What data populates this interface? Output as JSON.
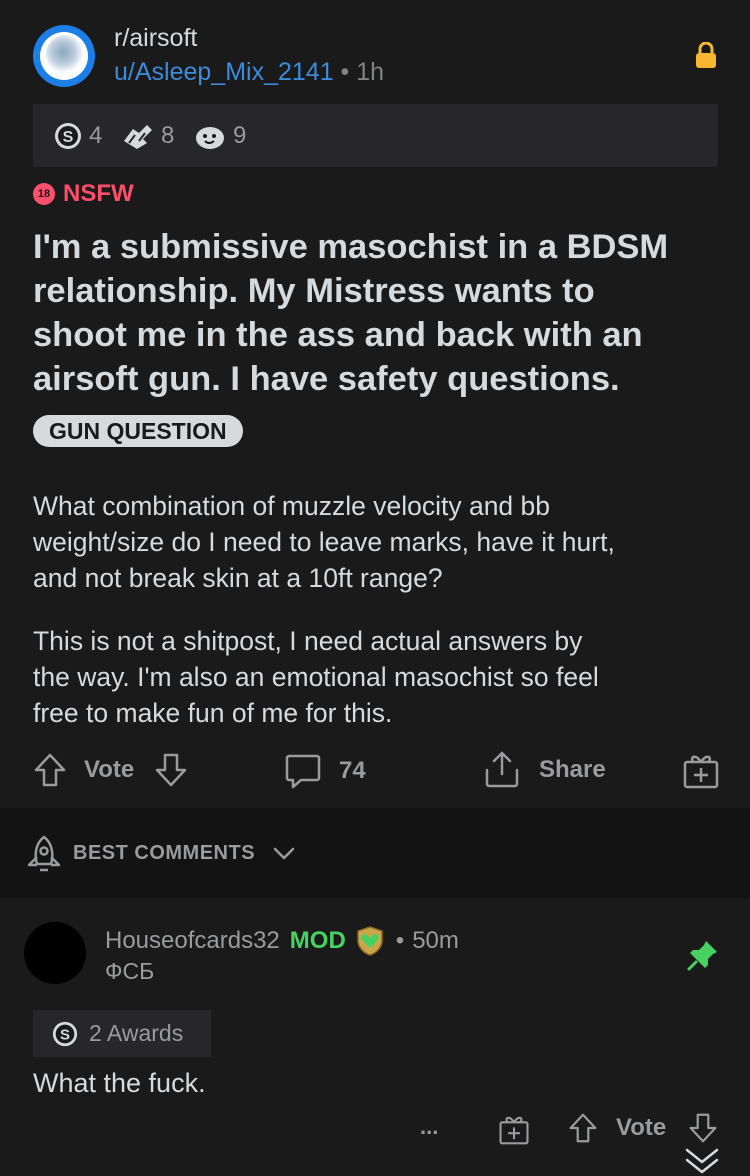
{
  "post": {
    "subreddit": "r/airsoft",
    "username": "u/Asleep_Mix_2141",
    "separator": "•",
    "age": "1h",
    "awards": [
      {
        "icon": "silver-award-icon",
        "count": "4"
      },
      {
        "icon": "helpful-hands-award-icon",
        "count": "8"
      },
      {
        "icon": "wholesome-award-icon",
        "count": "9"
      }
    ],
    "nsfw_badge": "18",
    "nsfw_label": "NSFW",
    "title_lines": [
      "I'm a submissive masochist in a BDSM",
      "relationship. My Mistress wants to",
      "shoot me in the ass and back with an",
      "airsoft gun. I have safety questions."
    ],
    "flair": "GUN QUESTION",
    "body_p1_lines": [
      "What combination of muzzle velocity and bb",
      "weight/size do I need to leave marks, have it hurt,",
      "and not break skin at a 10ft range?"
    ],
    "body_p2_lines": [
      "This is not a shitpost, I need actual answers by",
      "the way. I'm also an emotional masochist so feel",
      "free to make fun of me for this."
    ],
    "actions": {
      "vote_label": "Vote",
      "comment_count": "74",
      "share_label": "Share"
    }
  },
  "comments_header": {
    "sort_label": "BEST COMMENTS"
  },
  "comment": {
    "username": "Houseofcards32",
    "mod_label": "MOD",
    "separator": "•",
    "age": "50m",
    "user_flair": "ФСБ",
    "awards_label": "2 Awards",
    "text": "What the fuck.",
    "more_label": "...",
    "vote_label": "Vote"
  },
  "colors": {
    "post_bg": "#1a1a1b",
    "username_blue": "#3d8bd9",
    "nsfw_red": "#ff4f6a",
    "mod_green": "#46d160",
    "lock_orange": "#f7b733"
  }
}
